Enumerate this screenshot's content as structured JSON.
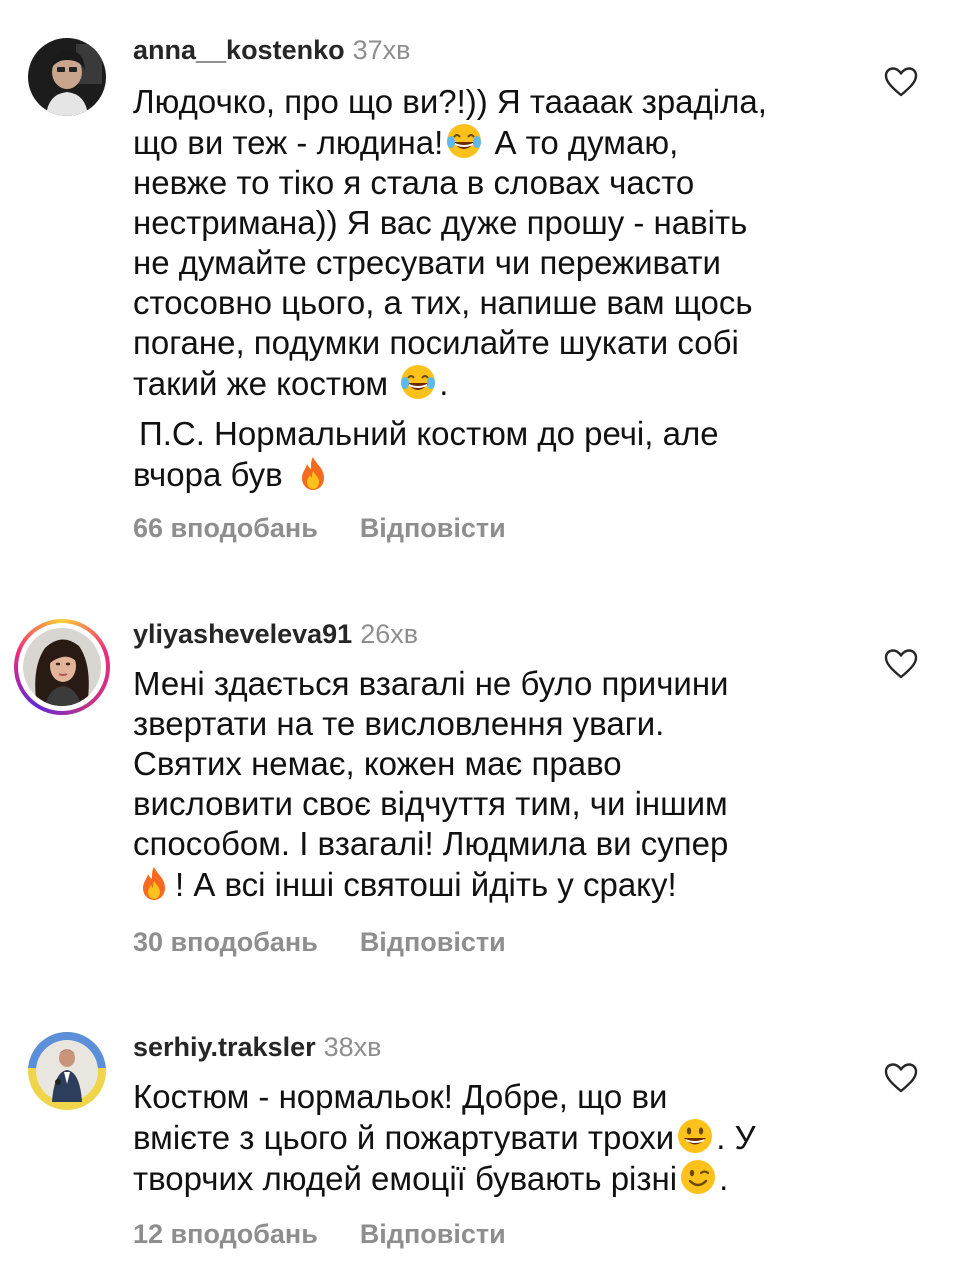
{
  "comments": [
    {
      "username": "anna__kostenko",
      "time": "37хв",
      "text": {
        "l1": "Людочко, про що ви?!)) Я таааак зраділа,",
        "l2a": "що ви теж - людина!",
        "l2b": " А то думаю,",
        "l3": "невже то тіко я стала в словах часто",
        "l4": "нестримана)) Я вас дуже прошу - навіть",
        "l5": "не думайте стресувати чи переживати",
        "l6": "стосовно цього, а  тих, напише вам щось",
        "l7": "погане, подумки посилайте шукати собі",
        "l8a": "такий же костюм ",
        "l8b": ".",
        "ps1": "П.С. Нормальний костюм до речі, але",
        "ps2": "вчора був "
      },
      "likes": "66 вподобань",
      "reply": "Відповісти"
    },
    {
      "username": "yliyasheveleva91",
      "time": "26хв",
      "text": {
        "l1": "Мені здається взагалі не було причини",
        "l2": "звертати на те висловлення уваги.",
        "l3": "Святих немає, кожен має право",
        "l4": "висловити своє відчуття тим, чи іншим",
        "l5": "способом. І взагалі! Людмила ви супер",
        "l6b": "! А всі інші святоші йдіть у сраку!"
      },
      "likes": "30 вподобань",
      "reply": "Відповісти"
    },
    {
      "username": "serhiy.traksler",
      "time": "38хв",
      "text": {
        "l1": "Костюм - нормальок! Добре, що ви",
        "l2a": "вмієте з цього й пожартувати трохи",
        "l2b": ". У",
        "l3a": "творчих людей емоції бувають різні",
        "l3b": "."
      },
      "likes": "12 вподобань",
      "reply": "Відповісти"
    }
  ],
  "icons": {
    "like": "heart-outline-icon",
    "emoji_laugh": "face-with-tears-of-joy",
    "emoji_fire": "fire",
    "emoji_smile": "grinning-face",
    "emoji_wink": "winking-face"
  },
  "colors": {
    "username": "#262626",
    "meta": "#8e8e8e",
    "text": "#111111",
    "story_ring": [
      "#f9ce34",
      "#ee2a7b",
      "#6228d7"
    ]
  }
}
